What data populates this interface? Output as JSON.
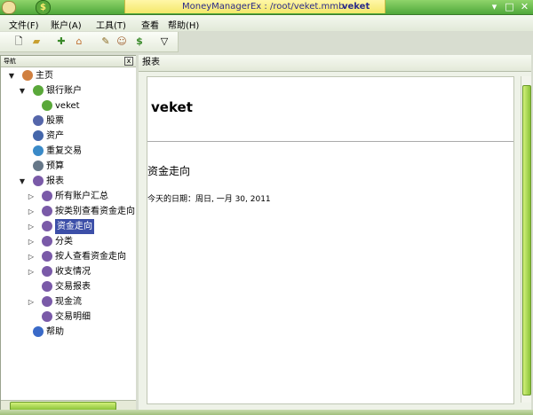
{
  "window": {
    "title": "MoneyManagerEx : /root/veket.mmb",
    "app_name": "veket",
    "controls": [
      "▾",
      "□",
      "✕"
    ]
  },
  "menu": [
    {
      "label": "文件(F)"
    },
    {
      "label": "账户(A)"
    },
    {
      "label": "工具(T)"
    },
    {
      "label": "查看"
    },
    {
      "label": "帮助(H)"
    }
  ],
  "toolbar": {
    "icons": [
      "new-file-icon",
      "open-folder-icon",
      "new-account-icon",
      "home-icon",
      "edit-icon",
      "user-icon",
      "currency-icon",
      "filter-icon"
    ]
  },
  "navigator": {
    "header": "导航",
    "close": "x",
    "tree": [
      {
        "label": "主页",
        "arrow": "▼",
        "icon": "home-icon",
        "color": "#d08040"
      },
      {
        "label": "银行账户",
        "arrow": "▼",
        "icon": "bank-icon",
        "color": "#5aa83a"
      },
      {
        "label": "veket",
        "arrow": "",
        "icon": "account-icon",
        "color": "#5aa83a"
      },
      {
        "label": "股票",
        "arrow": "",
        "icon": "stocks-icon",
        "color": "#5566aa"
      },
      {
        "label": "资产",
        "arrow": "",
        "icon": "car-icon",
        "color": "#4466aa"
      },
      {
        "label": "重复交易",
        "arrow": "",
        "icon": "repeat-icon",
        "color": "#3a8ac8"
      },
      {
        "label": "预算",
        "arrow": "",
        "icon": "budget-icon",
        "color": "#667788"
      },
      {
        "label": "报表",
        "arrow": "▼",
        "icon": "report-icon",
        "color": "#7a5aa8"
      },
      {
        "label": "所有账户汇总",
        "arrow": "▷",
        "icon": "report-icon",
        "color": "#7a5aa8"
      },
      {
        "label": "按类别查看资金走向",
        "arrow": "▷",
        "icon": "report-icon",
        "color": "#7a5aa8"
      },
      {
        "label": "资金走向",
        "arrow": "▷",
        "icon": "report-icon",
        "color": "#7a5aa8",
        "selected": true
      },
      {
        "label": "分类",
        "arrow": "▷",
        "icon": "report-icon",
        "color": "#7a5aa8"
      },
      {
        "label": "按人查看资金走向",
        "arrow": "▷",
        "icon": "report-icon",
        "color": "#7a5aa8"
      },
      {
        "label": "收支情况",
        "arrow": "▷",
        "icon": "report-icon",
        "color": "#7a5aa8"
      },
      {
        "label": "交易报表",
        "arrow": "",
        "icon": "report-icon",
        "color": "#7a5aa8"
      },
      {
        "label": "现金流",
        "arrow": "▷",
        "icon": "report-icon",
        "color": "#7a5aa8"
      },
      {
        "label": "交易明细",
        "arrow": "",
        "icon": "report-icon",
        "color": "#7a5aa8"
      },
      {
        "label": "帮助",
        "arrow": "",
        "icon": "help-icon",
        "color": "#3a6ac8"
      }
    ]
  },
  "report": {
    "tab_label": "报表",
    "db_name": "veket",
    "subtitle": "资金走向",
    "date_line": "今天的日期：周日, 一月 30, 2011"
  },
  "colors": {
    "titlebar_green": "#4fa83a",
    "selection_blue": "#3c4fa8",
    "scroll_green": "#8cc43a"
  }
}
